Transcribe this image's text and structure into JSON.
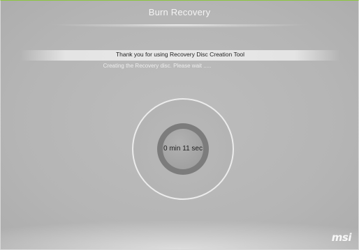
{
  "window": {
    "title": "Burn Recovery"
  },
  "banner": {
    "text": "Thank you for using Recovery Disc Creation Tool"
  },
  "status": {
    "text": "Creating the Recovery disc. Please wait ....."
  },
  "progress": {
    "elapsed_text": "0 min 11 sec"
  },
  "brand": {
    "logo_text": "msi"
  },
  "colors": {
    "background": "#b5b5b5",
    "disc_ring": "#7c7c7c",
    "title_text": "#f4f4f4",
    "window_top_border": "#8cc63f"
  },
  "icons": {
    "disc": "disc-icon"
  }
}
